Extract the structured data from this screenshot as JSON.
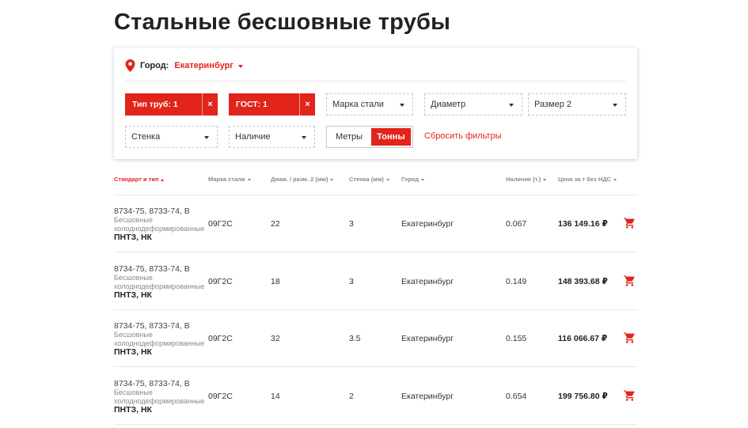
{
  "page": {
    "title": "Стальные бесшовные трубы"
  },
  "filters": {
    "city_label": "Город:",
    "city_value": "Екатеринбург",
    "chips": [
      {
        "label": "Тип труб: 1",
        "close": "×"
      },
      {
        "label": "ГОСТ: 1",
        "close": "×"
      }
    ],
    "selects": {
      "steel_grade": "Марка стали",
      "diameter": "Диаметр",
      "size2": "Размер 2",
      "wall": "Стенка",
      "availability": "Наличие"
    },
    "units": {
      "meters": "Метры",
      "tons": "Тонны",
      "selected": "Тонны"
    },
    "reset": "Сбросить фильтры"
  },
  "table": {
    "columns": [
      "Стандарт и тип",
      "Марка стали",
      "Диам. / разм. 2 (мм)",
      "Стенка (мм)",
      "Город",
      "Наличие (т.)",
      "Цена за т без НДС"
    ],
    "rows": [
      {
        "standard": "8734-75, 8733-74, В",
        "type": "Бесшовные холоднодеформированные",
        "maker": "ПНТЗ, НК",
        "grade": "09Г2С",
        "diameter": "22",
        "wall": "3",
        "city": "Екатеринбург",
        "stock": "0.067",
        "price": "136 149.16 ₽"
      },
      {
        "standard": "8734-75, 8733-74, В",
        "type": "Бесшовные холоднодеформированные",
        "maker": "ПНТЗ, НК",
        "grade": "09Г2С",
        "diameter": "18",
        "wall": "3",
        "city": "Екатеринбург",
        "stock": "0.149",
        "price": "148 393.68 ₽"
      },
      {
        "standard": "8734-75, 8733-74, В",
        "type": "Бесшовные холоднодеформированные",
        "maker": "ПНТЗ, НК",
        "grade": "09Г2С",
        "diameter": "32",
        "wall": "3.5",
        "city": "Екатеринбург",
        "stock": "0.155",
        "price": "116 066.67 ₽"
      },
      {
        "standard": "8734-75, 8733-74, В",
        "type": "Бесшовные холоднодеформированные",
        "maker": "ПНТЗ, НК",
        "grade": "09Г2С",
        "diameter": "14",
        "wall": "2",
        "city": "Екатеринбург",
        "stock": "0.654",
        "price": "199 756.80 ₽"
      }
    ]
  },
  "icons": {
    "location": "map-pin-icon",
    "cart": "shopping-cart-icon",
    "accent": "#e2241b"
  }
}
